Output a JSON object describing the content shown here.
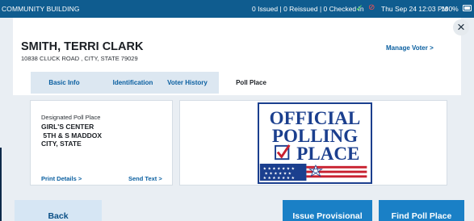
{
  "status_bar": {
    "venue": "COMMUNITY BUILDING",
    "counts": "0 Issued | 0 Reissued | 0 Checked In",
    "clock": "Thu Sep 24  12:03 PM",
    "battery": "100%"
  },
  "voter": {
    "name": "SMITH, TERRI CLARK",
    "address": "10838 CLUCK ROAD , CITY, STATE 79029",
    "manage_label": "Manage Voter >"
  },
  "close_label": "×",
  "tabs": [
    {
      "label": "Basic Info"
    },
    {
      "label": "Identification"
    },
    {
      "label": "Voter History"
    },
    {
      "label": "Poll Place"
    }
  ],
  "poll_place": {
    "label": "Designated Poll Place",
    "name": "GIRL'S CENTER",
    "street": " 5TH & S MADDOX",
    "city": "CITY, STATE",
    "print_label": "Print Details >",
    "send_label": "Send Text >"
  },
  "sign": {
    "line1": "OFFICIAL",
    "line2": "POLLING",
    "line3": "PLACE"
  },
  "buttons": {
    "back": "Back",
    "issue": "Issue Provisional",
    "find": "Find Poll Place"
  },
  "colors": {
    "topbar": "#0f5c8f",
    "accent": "#1a80c6",
    "link": "#0a5fa0",
    "sign_blue": "#1b3f8e",
    "sign_red": "#c8202f"
  }
}
